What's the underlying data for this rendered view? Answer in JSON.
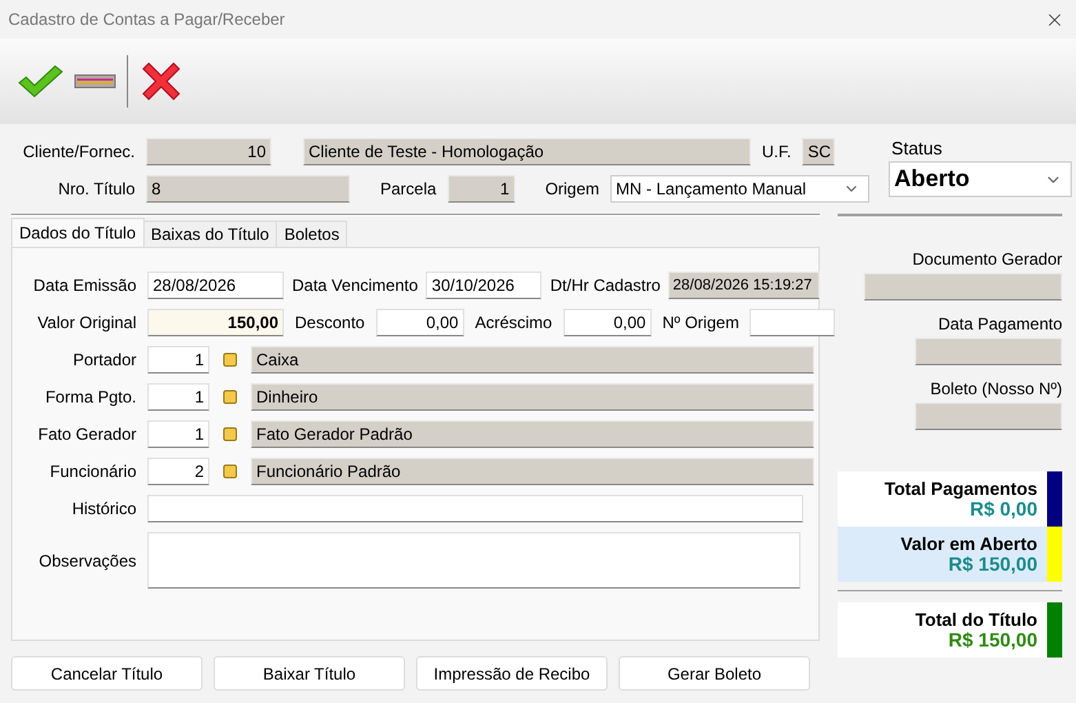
{
  "window": {
    "title": "Cadastro de Contas a Pagar/Receber"
  },
  "header": {
    "client_label": "Cliente/Fornec.",
    "client_code": "10",
    "client_name": "Cliente de Teste - Homologação",
    "uf_label": "U.F.",
    "uf": "SC",
    "title_label": "Nro. Título",
    "title_number": "8",
    "parcela_label": "Parcela",
    "parcela": "1",
    "origem_label": "Origem",
    "origem": "MN - Lançamento Manual",
    "status_label": "Status",
    "status": "Aberto"
  },
  "tabs": [
    {
      "label": "Dados do Título",
      "selected": true
    },
    {
      "label": "Baixas do Título",
      "selected": false
    },
    {
      "label": "Boletos",
      "selected": false
    }
  ],
  "form": {
    "emissao_label": "Data Emissão",
    "emissao": "28/08/2026",
    "vencimento_label": "Data Vencimento",
    "vencimento": "30/10/2026",
    "cadastro_label": "Dt/Hr Cadastro",
    "cadastro": "28/08/2026 15:19:27",
    "valor_label": "Valor Original",
    "valor": "150,00",
    "desconto_label": "Desconto",
    "desconto": "0,00",
    "acrescimo_label": "Acréscimo",
    "acrescimo": "0,00",
    "origem_num_label": "Nº Origem",
    "historico_label": "Histórico",
    "observacoes_label": "Observações"
  },
  "lookups": [
    {
      "label": "Portador",
      "code": "1",
      "name": "Caixa"
    },
    {
      "label": "Forma Pgto.",
      "code": "1",
      "name": "Dinheiro"
    },
    {
      "label": "Fato Gerador",
      "code": "1",
      "name": "Fato Gerador Padrão"
    },
    {
      "label": "Funcionário",
      "code": "2",
      "name": "Funcionário Padrão"
    }
  ],
  "side_fields": [
    {
      "label": "Documento Gerador",
      "kind": "wide"
    },
    {
      "label": "Data Pagamento",
      "kind": "narrow"
    },
    {
      "label": "Boleto (Nosso Nº)",
      "kind": "narrow"
    }
  ],
  "totals": [
    {
      "label": "Total Pagamentos",
      "value": "R$ 0,00",
      "color": "#000080",
      "highlighted": false,
      "kind": "partial"
    },
    {
      "label": "Valor em Aberto",
      "value": "R$ 150,00",
      "color": "#ffff00",
      "highlighted": true,
      "kind": "partial"
    },
    {
      "label": "Total do Título",
      "value": "R$ 150,00",
      "color": "#008000",
      "highlighted": false,
      "kind": "grand"
    }
  ],
  "buttons": [
    "Cancelar Título",
    "Baixar Título",
    "Impressão de Recibo",
    "Gerar Boleto"
  ]
}
